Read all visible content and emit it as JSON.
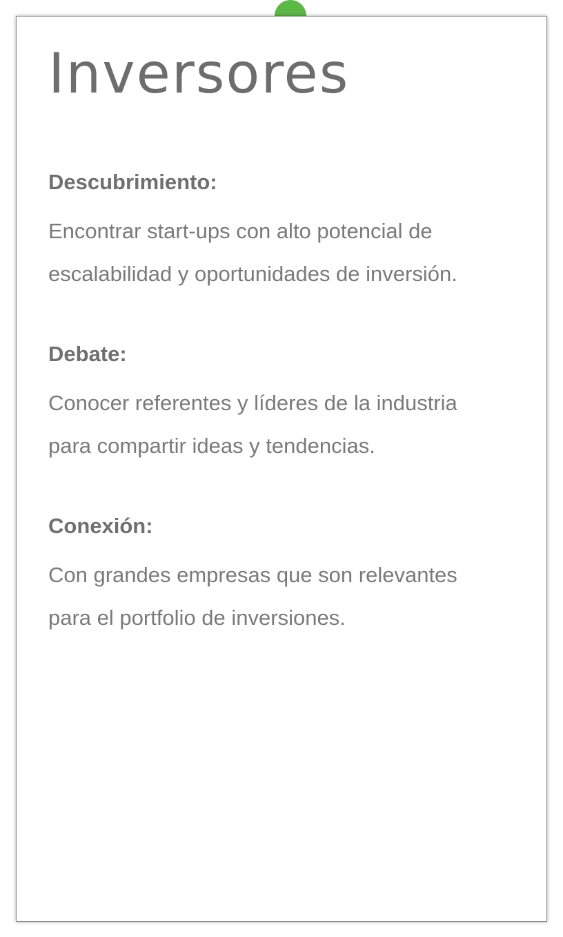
{
  "page": {
    "title": "Inversores",
    "accent_color": "#5cb845"
  },
  "sections": [
    {
      "heading": "Descubrimiento:",
      "body": "Encontrar start-ups con alto potencial de\nescalabilidad y oportunidades de inversión."
    },
    {
      "heading": "Debate:",
      "body": "Conocer referentes y líderes de la industria\npara compartir ideas y tendencias."
    },
    {
      "heading": "Conexión:",
      "body": "Con grandes empresas que son relevantes\npara el portfolio de inversiones."
    }
  ]
}
